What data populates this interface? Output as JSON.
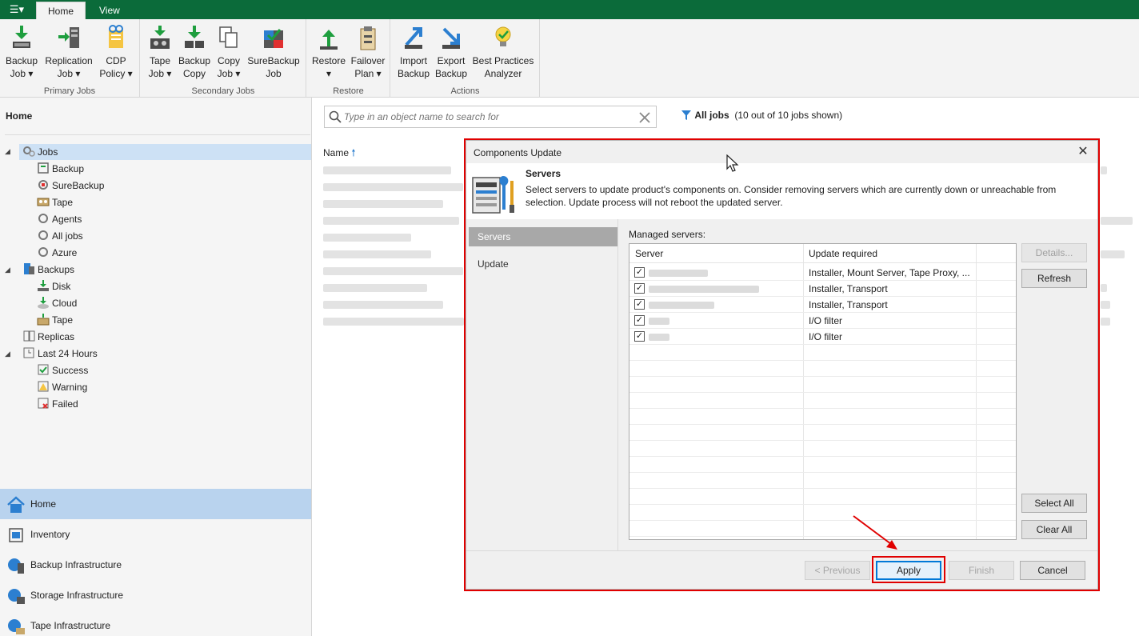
{
  "tabs": [
    {
      "label": "Home"
    },
    {
      "label": "View"
    }
  ],
  "menu_glyph": "☰▾",
  "ribbon": {
    "groups": [
      {
        "label": "Primary Jobs",
        "buttons": [
          {
            "line1": "Backup",
            "line2": "Job ▾"
          },
          {
            "line1": "Replication",
            "line2": "Job ▾"
          },
          {
            "line1": "CDP",
            "line2": "Policy ▾"
          }
        ]
      },
      {
        "label": "Secondary Jobs",
        "buttons": [
          {
            "line1": "Tape",
            "line2": "Job ▾"
          },
          {
            "line1": "Backup",
            "line2": "Copy"
          },
          {
            "line1": "Copy",
            "line2": "Job ▾"
          },
          {
            "line1": "SureBackup",
            "line2": "Job"
          }
        ]
      },
      {
        "label": "Restore",
        "buttons": [
          {
            "line1": "Restore",
            "line2": "▾"
          },
          {
            "line1": "Failover",
            "line2": "Plan ▾"
          }
        ]
      },
      {
        "label": "Actions",
        "buttons": [
          {
            "line1": "Import",
            "line2": "Backup"
          },
          {
            "line1": "Export",
            "line2": "Backup"
          },
          {
            "line1": "Best Practices",
            "line2": "Analyzer"
          }
        ]
      }
    ]
  },
  "left": {
    "title": "Home",
    "tree": [
      {
        "label": "Jobs"
      },
      {
        "label": "Backup"
      },
      {
        "label": "SureBackup"
      },
      {
        "label": "Tape"
      },
      {
        "label": "Agents"
      },
      {
        "label": "All jobs"
      },
      {
        "label": "Azure"
      },
      {
        "label": "Backups"
      },
      {
        "label": "Disk"
      },
      {
        "label": "Cloud"
      },
      {
        "label": "Tape"
      },
      {
        "label": "Replicas"
      },
      {
        "label": "Last 24 Hours"
      },
      {
        "label": "Success"
      },
      {
        "label": "Warning"
      },
      {
        "label": "Failed"
      }
    ],
    "nav": [
      {
        "label": "Home"
      },
      {
        "label": "Inventory"
      },
      {
        "label": "Backup Infrastructure"
      },
      {
        "label": "Storage Infrastructure"
      },
      {
        "label": "Tape Infrastructure"
      }
    ]
  },
  "main": {
    "search_placeholder": "Type in an object name to search for",
    "filter_label": "All jobs",
    "filter_count": "(10 out of 10 jobs shown)",
    "col_name": "Name"
  },
  "dialog": {
    "title": "Components Update",
    "heading": "Servers",
    "description": "Select servers to update product's components on. Consider removing servers which are currently down or unreachable from selection. Update process will not reboot the updated server.",
    "steps": [
      {
        "label": "Servers"
      },
      {
        "label": "Update"
      }
    ],
    "managed_label": "Managed servers:",
    "columns": {
      "server": "Server",
      "update": "Update required"
    },
    "rows": [
      {
        "update": "Installer, Mount Server, Tape Proxy, ...",
        "checked": true
      },
      {
        "update": "Installer, Transport",
        "checked": true
      },
      {
        "update": "Installer, Transport",
        "checked": true
      },
      {
        "update": "I/O filter",
        "checked": true
      },
      {
        "update": "I/O filter",
        "checked": true
      }
    ],
    "side_buttons": {
      "details": "Details...",
      "refresh": "Refresh",
      "select_all": "Select All",
      "clear_all": "Clear All"
    },
    "footer": {
      "previous": "< Previous",
      "apply": "Apply",
      "finish": "Finish",
      "cancel": "Cancel"
    }
  },
  "colors": {
    "accent": "#0b6b3a",
    "highlight": "#e00000",
    "selection": "#cde1f5"
  }
}
